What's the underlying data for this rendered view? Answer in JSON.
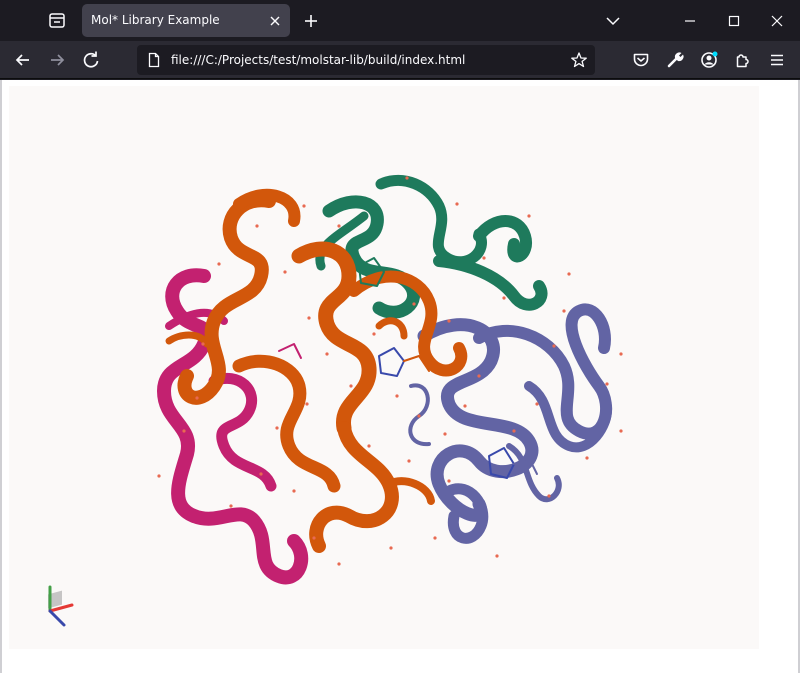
{
  "tab": {
    "title": "Mol* Library Example"
  },
  "address_bar": {
    "url": "file:///C:/Projects/test/molstar-lib/build/index.html"
  },
  "icons": {
    "tab_list": "tab-list-icon",
    "close_tab": "close-icon",
    "new_tab": "plus-icon",
    "dropdown": "chevron-down-icon",
    "minimize": "minimize-icon",
    "maximize": "maximize-icon",
    "close_window": "close-icon",
    "back": "arrow-left-icon",
    "forward": "arrow-right-icon",
    "reload": "reload-icon",
    "page": "file-icon",
    "bookmark": "star-icon",
    "pocket": "pocket-icon",
    "tools": "wrench-icon",
    "account": "account-icon",
    "extensions": "puzzle-icon",
    "menu": "hamburger-icon"
  },
  "viewer": {
    "background": "#fbf9f8",
    "chain_colors": {
      "chain_a": "#1e7a5c",
      "chain_b": "#d2570b",
      "chain_c": "#c32170",
      "chain_d": "#6264a4"
    },
    "water_color": "#e86a52",
    "axes": {
      "x_color": "#e53935",
      "y_color": "#43a047",
      "z_color": "#3949ab"
    }
  },
  "theme": {
    "tabstrip": "#1c1b22",
    "navbar": "#2b2a33",
    "tab_active": "#42414d",
    "text": "#fbfbfe"
  }
}
